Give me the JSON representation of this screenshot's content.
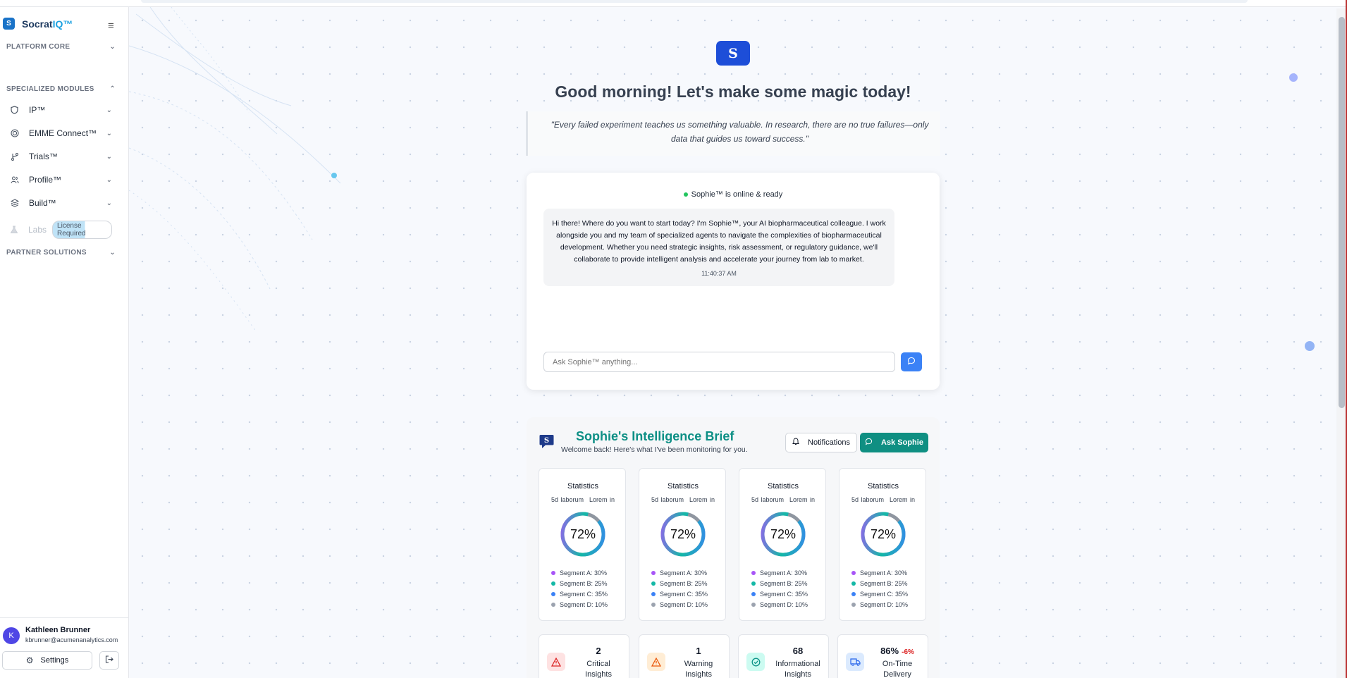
{
  "app": {
    "name_a": "Socrat",
    "name_b": "IQ™",
    "logo_letter": "S"
  },
  "sidebar": {
    "sections": {
      "platform_core": "PLATFORM CORE",
      "specialized_modules": "SPECIALIZED MODULES",
      "partner_solutions": "PARTNER SOLUTIONS"
    },
    "modules": [
      {
        "label": "IP™",
        "icon": "shield-icon"
      },
      {
        "label": "EMME Connect™",
        "icon": "target-icon"
      },
      {
        "label": "Trials™",
        "icon": "branch-icon"
      },
      {
        "label": "Profile™",
        "icon": "users-icon"
      },
      {
        "label": "Build™",
        "icon": "layers-icon"
      }
    ],
    "labs": {
      "label": "Labs",
      "badge": "License Required",
      "icon": "flask-icon"
    },
    "user": {
      "initial": "K",
      "name": "Kathleen Brunner",
      "email": "kbrunner@acumenanalytics.com"
    },
    "settings_label": "Settings"
  },
  "hero": {
    "badge": "S",
    "greeting": "Good morning! Let's make some magic today!",
    "quote": "\"Every failed experiment teaches us something valuable. In research, there are no true failures—only data that guides us toward success.\""
  },
  "chat": {
    "status": "Sophie™ is online & ready",
    "message": "Hi there! Where do you want to start today? I'm Sophie™, your AI biopharmaceutical colleague. I work alongside you and my team of specialized agents to navigate the complexities of biopharmaceutical development. Whether you need strategic insights, risk assessment, or regulatory guidance, we'll collaborate to provide intelligent analysis and accelerate your journey from lab to market.",
    "time": "11:40:37 AM",
    "placeholder": "Ask Sophie™ anything..."
  },
  "brief": {
    "title": "Sophie's Intelligence Brief",
    "subtitle": "Welcome back! Here's what I've been monitoring for you.",
    "notifications_label": "Notifications",
    "ask_label": "Ask Sophie",
    "stat_cards": [
      {
        "title": "Statistics",
        "range_a": "5d laborum",
        "range_b": "Lorem in",
        "percent": "72%"
      },
      {
        "title": "Statistics",
        "range_a": "5d laborum",
        "range_b": "Lorem in",
        "percent": "72%"
      },
      {
        "title": "Statistics",
        "range_a": "5d laborum",
        "range_b": "Lorem in",
        "percent": "72%"
      },
      {
        "title": "Statistics",
        "range_a": "5d laborum",
        "range_b": "Lorem in",
        "percent": "72%"
      }
    ],
    "segments": [
      {
        "label": "Segment A: 30%",
        "color": "#a855f7"
      },
      {
        "label": "Segment B: 25%",
        "color": "#14b8a6"
      },
      {
        "label": "Segment C: 35%",
        "color": "#3b82f6"
      },
      {
        "label": "Segment D: 10%",
        "color": "#9ca3af"
      }
    ],
    "kpis": [
      {
        "value": "2",
        "delta": "",
        "label_a": "Critical",
        "label_b": "Insights",
        "icon": "alert-triangle-icon",
        "color": "#dc2626",
        "bg": "#fee2e2"
      },
      {
        "value": "1",
        "delta": "",
        "label_a": "Warning",
        "label_b": "Insights",
        "icon": "warning-icon",
        "color": "#ea580c",
        "bg": "#ffedd5"
      },
      {
        "value": "68",
        "delta": "",
        "label_a": "Informational",
        "label_b": "Insights",
        "icon": "check-circle-icon",
        "color": "#0d9488",
        "bg": "#ccfbf1"
      },
      {
        "value": "86%",
        "delta": "-6%",
        "label_a": "On-Time",
        "label_b": "Delivery",
        "icon": "truck-icon",
        "color": "#2563eb",
        "bg": "#dbeafe"
      }
    ]
  }
}
